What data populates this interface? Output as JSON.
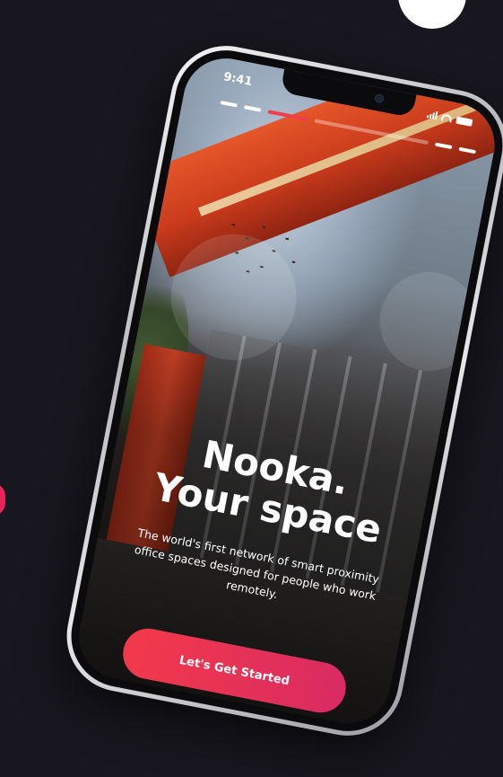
{
  "status_bar": {
    "time": "9:41"
  },
  "onboarding": {
    "headline_line1": "Nooka.",
    "headline_line2": "Your space",
    "description": "The world's first network of smart proximity office spaces designed for people who work remotely.",
    "cta_label": "Let's Get Started",
    "progress": {
      "segments": 6,
      "active_index": 2
    }
  },
  "colors": {
    "background": "#18171f",
    "accent": "#f23e4b",
    "button_gradient_start": "#f3394a",
    "button_gradient_end": "#d92b63"
  }
}
